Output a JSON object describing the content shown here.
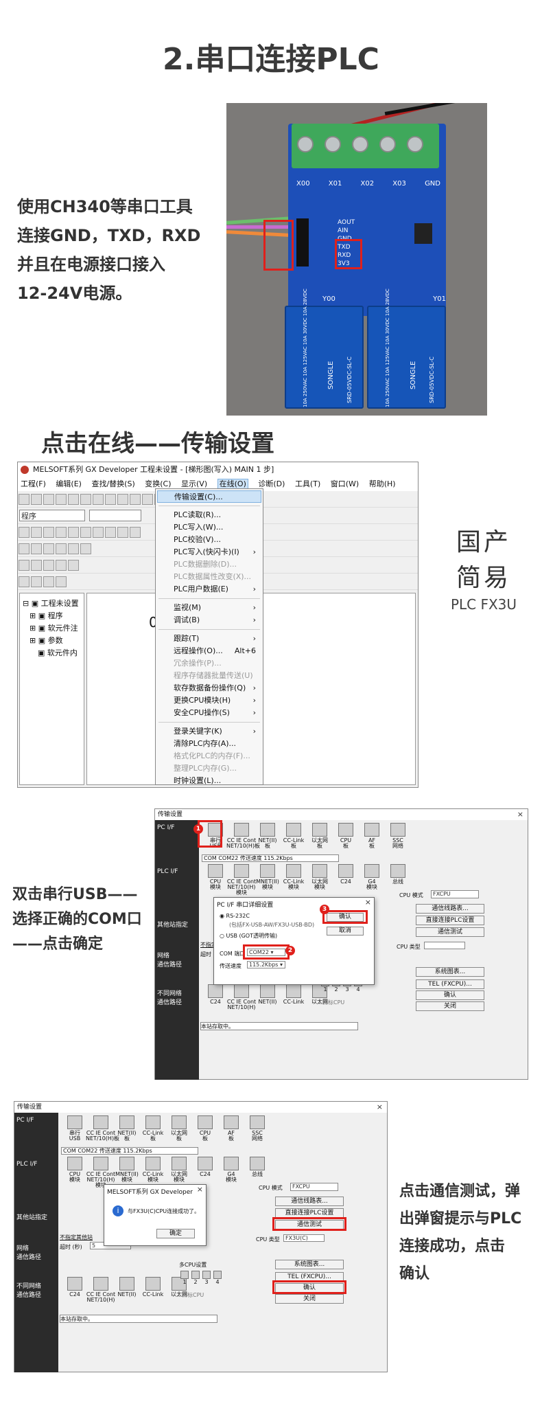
{
  "section1": {
    "title": "2.串口连接PLC",
    "caption_lines": [
      "使用CH340等串口工具",
      "连接GND，TXD，RXD",
      "并且在电源接口接入",
      "12-24V电源。"
    ]
  },
  "board": {
    "top_labels": [
      "X00",
      "X01",
      "X02",
      "X03",
      "GND"
    ],
    "pins": [
      "AOUT",
      "AIN",
      "GND",
      "TXD",
      "RXD",
      "3V3"
    ],
    "out_labels": [
      "Y00",
      "Y01"
    ],
    "relay_text": "SONGLE",
    "relay_model": "SRD-05VDC-SL-C",
    "relay_rating": "10A 250VAC 10A 125VAC 10A 30VDC 10A 28VDC"
  },
  "section2": {
    "title": "点击在线——传输设置",
    "product_line1": "国产",
    "product_line2": "简易",
    "product_model": "PLC FX3U"
  },
  "gx": {
    "title": "MELSOFT系列 GX Developer 工程未设置 - [梯形图(写入)    MAIN    1 步]",
    "menu": [
      "工程(F)",
      "编辑(E)",
      "查找/替换(S)",
      "变换(C)",
      "显示(V)",
      "在线(O)",
      "诊断(D)",
      "工具(T)",
      "窗口(W)",
      "帮助(H)"
    ],
    "combo1": "程序",
    "tree": [
      "工程未设置",
      "程序",
      "软元件注",
      "参数",
      "软元件内"
    ],
    "ladder_step": "0",
    "dropdown": [
      {
        "label": "传输设置(C)...",
        "state": "hl"
      },
      {
        "sep": true
      },
      {
        "label": "PLC读取(R)..."
      },
      {
        "label": "PLC写入(W)..."
      },
      {
        "label": "PLC校验(V)..."
      },
      {
        "label": "PLC写入(快闪卡)(I)",
        "arrow": "›"
      },
      {
        "label": "PLC数据删除(D)...",
        "state": "dis"
      },
      {
        "label": "PLC数据属性改变(X)...",
        "state": "dis"
      },
      {
        "label": "PLC用户数据(E)",
        "arrow": "›"
      },
      {
        "sep": true
      },
      {
        "label": "监视(M)",
        "arrow": "›"
      },
      {
        "label": "调试(B)",
        "arrow": "›"
      },
      {
        "sep": true
      },
      {
        "label": "跟踪(T)",
        "arrow": "›"
      },
      {
        "label": "远程操作(O)...",
        "shortcut": "Alt+6"
      },
      {
        "label": "冗余操作(P)...",
        "state": "dis"
      },
      {
        "label": "程序存储器批量传送(U)",
        "state": "dis"
      },
      {
        "label": "软存数据备份操作(Q)",
        "arrow": "›"
      },
      {
        "label": "更换CPU模块(H)",
        "arrow": "›"
      },
      {
        "label": "安全CPU操作(S)",
        "arrow": "›"
      },
      {
        "sep": true
      },
      {
        "label": "登录关键字(K)",
        "arrow": "›"
      },
      {
        "label": "清除PLC内存(A)..."
      },
      {
        "label": "格式化PLC的内存(F)...",
        "state": "dis"
      },
      {
        "label": "整理PLC内存(G)...",
        "state": "dis"
      },
      {
        "label": "时钟设置(L)..."
      }
    ]
  },
  "section3": {
    "caption_lines": [
      "双击串行USB——",
      "选择正确的COM口",
      "——点击确定"
    ]
  },
  "xfer": {
    "title": "传输设置",
    "pcif": "PC I/F",
    "plcif": "PLC I/F",
    "other": "其他站指定",
    "route": "网络\n通信路径",
    "diffnet": "不同网络\n通信路径",
    "top_icons": [
      "串行\nUSB",
      "CC IE Cont\nNET/10(H)板",
      "NET(II)\n板",
      "CC-Link\n板",
      "以太网\n板",
      "CPU\n板",
      "AF\n板",
      "SSC\n网络"
    ],
    "plc_icons": [
      "CPU\n模块",
      "CC IE Cont\nNET/10(H)\n模块",
      "MNET(II)\n模块",
      "CC-Link\n模块",
      "以太网\n模块",
      "C24",
      "G4\n模块",
      "总线"
    ],
    "com_line": "COM  COM22    传送速度  115.2Kbps",
    "cpu_mode": "CPU 模式",
    "cpu_mode_val": "FXCPU",
    "no_station": "不指定其他站",
    "timeout": "超时 (秒)",
    "timeout_val": "5",
    "bottom_icons": [
      "C24",
      "CC IE Cont\nNET/10(H)",
      "NET(II)",
      "CC-Link",
      "以太网"
    ],
    "status": "本站存取中。",
    "right_btns": [
      "通信线路表...",
      "直接连接PLC设置",
      "通信测试",
      "系统图表...",
      "TEL (FXCPU)...",
      "确认",
      "关闭"
    ],
    "cpu_type_label": "CPU 类型",
    "multi_cpu": "多CPU设置",
    "target_cpu": "目标CPU",
    "multi_nums": [
      "1",
      "2",
      "3",
      "4"
    ]
  },
  "pcif_dlg": {
    "title": "PC I/F 串口详细设置",
    "opt1": "RS-232C",
    "opt1_note": "(包括FX-USB-AW/FX3U-USB-BD)",
    "opt2": "USB (GOT透明传输)",
    "com_label": "COM 端口",
    "com_val": "COM22",
    "rate_label": "传送速度",
    "rate_val": "115.2Kbps",
    "ok": "确认",
    "cancel": "取消",
    "marks": [
      "1",
      "2",
      "3"
    ]
  },
  "section4": {
    "caption_lines": [
      "点击通信测试，弹",
      "出弹窗提示与PLC",
      "连接成功，点击",
      "确认"
    ]
  },
  "msg": {
    "title": "MELSOFT系列 GX Developer",
    "text": "与FX3U(C)CPU连接成功了。",
    "ok": "确定",
    "cpu_type_val": "FX3U(C)"
  }
}
